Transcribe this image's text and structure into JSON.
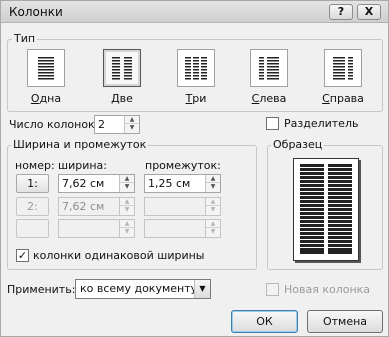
{
  "window": {
    "title": "Колонки",
    "help_label": "?",
    "close_label": "X"
  },
  "presets": {
    "group_label": "Тип",
    "items": [
      {
        "key": "one",
        "label": "Одна",
        "hotkey_index": 0,
        "selected": false
      },
      {
        "key": "two",
        "label": "Две",
        "hotkey_index": 0,
        "selected": true
      },
      {
        "key": "three",
        "label": "Три",
        "hotkey_index": 0,
        "selected": false
      },
      {
        "key": "left",
        "label": "Слева",
        "hotkey_index": 0,
        "selected": false
      },
      {
        "key": "right",
        "label": "Справа",
        "hotkey_index": 0,
        "selected": false
      }
    ]
  },
  "columns_count": {
    "label": "Число колонок:",
    "value": "2"
  },
  "separator": {
    "label": "Разделитель",
    "checked": false
  },
  "width_spacing": {
    "group_label": "Ширина и промежуток",
    "col_number": "номер:",
    "col_width": "ширина:",
    "col_spacing": "промежуток:",
    "rows": [
      {
        "number": "1:",
        "width": "7,62 см",
        "spacing": "1,25 см",
        "enabled": true
      },
      {
        "number": "2:",
        "width": "7,62 см",
        "spacing": "",
        "enabled": false
      },
      {
        "number": "",
        "width": "",
        "spacing": "",
        "enabled": false
      }
    ],
    "equal_width_label": "колонки одинаковой ширины",
    "equal_width_checked": true
  },
  "preview": {
    "group_label": "Образец"
  },
  "apply": {
    "label": "Применить:",
    "value": "ко всему документу"
  },
  "new_column": {
    "label": "Новая колонка",
    "checked": false
  },
  "buttons": {
    "ok": "ОК",
    "cancel": "Отмена"
  },
  "colors": {
    "dialog_bg": "#f0f0f0",
    "border": "#a8a8a8",
    "disabled_text": "#9a9a9a"
  }
}
